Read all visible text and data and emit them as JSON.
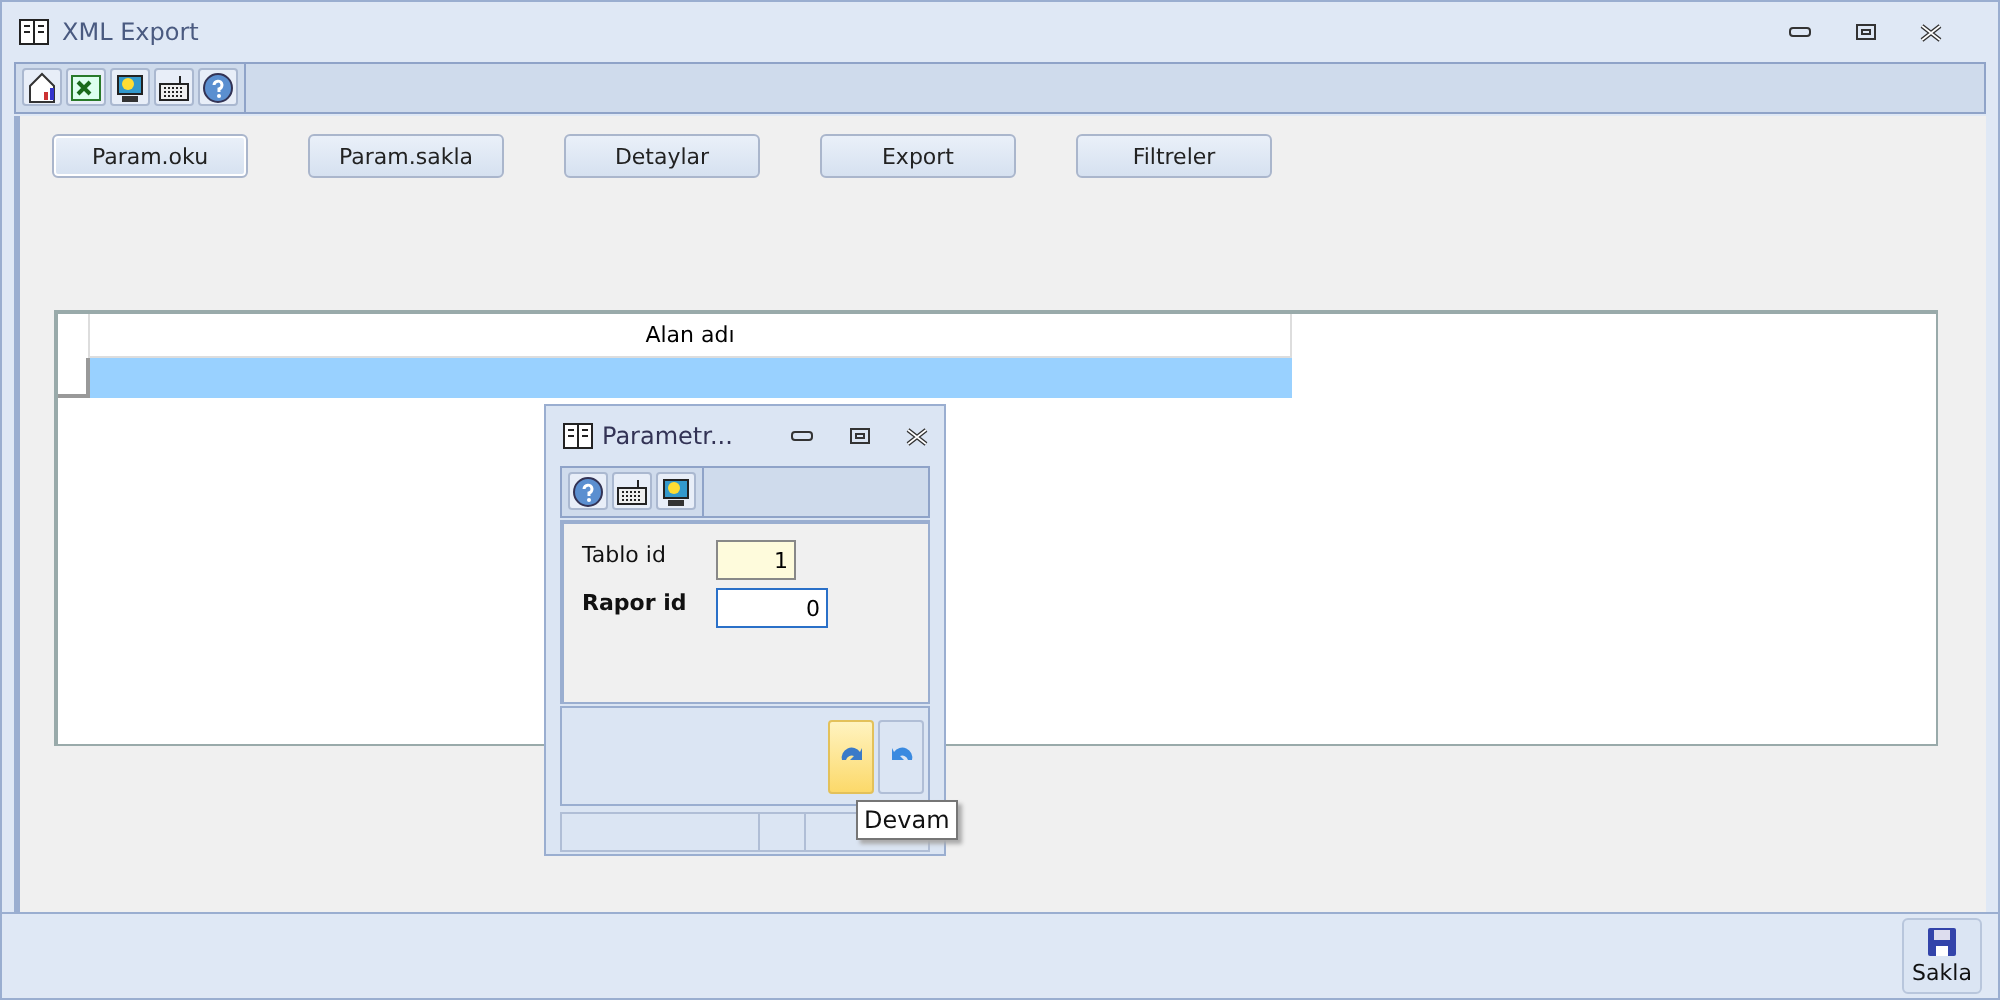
{
  "window": {
    "title": "XML Export"
  },
  "toolbar": [
    {
      "kind": "home"
    },
    {
      "kind": "excel"
    },
    {
      "kind": "screen"
    },
    {
      "kind": "keyboard"
    },
    {
      "kind": "help"
    }
  ],
  "buttons": [
    {
      "label": "Param.oku",
      "focused": true
    },
    {
      "label": "Param.sakla",
      "focused": false
    },
    {
      "label": "Detaylar",
      "focused": false
    },
    {
      "label": "Export",
      "focused": false
    },
    {
      "label": "Filtreler",
      "focused": false
    }
  ],
  "table": {
    "columns": [
      "Alan adı"
    ],
    "rows": [
      {
        "selected": true
      }
    ]
  },
  "dialog": {
    "title": "Parametr...",
    "toolbar": [
      {
        "kind": "help"
      },
      {
        "kind": "keyboard"
      },
      {
        "kind": "screen"
      }
    ],
    "fields": [
      {
        "label": "Tablo id",
        "value": "1",
        "bold": false,
        "focused": false
      },
      {
        "label": "Rapor id",
        "value": "0",
        "bold": true,
        "focused": true
      }
    ],
    "actions": [
      {
        "kind": "continue",
        "hover": true
      },
      {
        "kind": "undo",
        "hover": false
      }
    ],
    "tooltip": "Devam"
  },
  "save_button": {
    "label": "Sakla"
  }
}
